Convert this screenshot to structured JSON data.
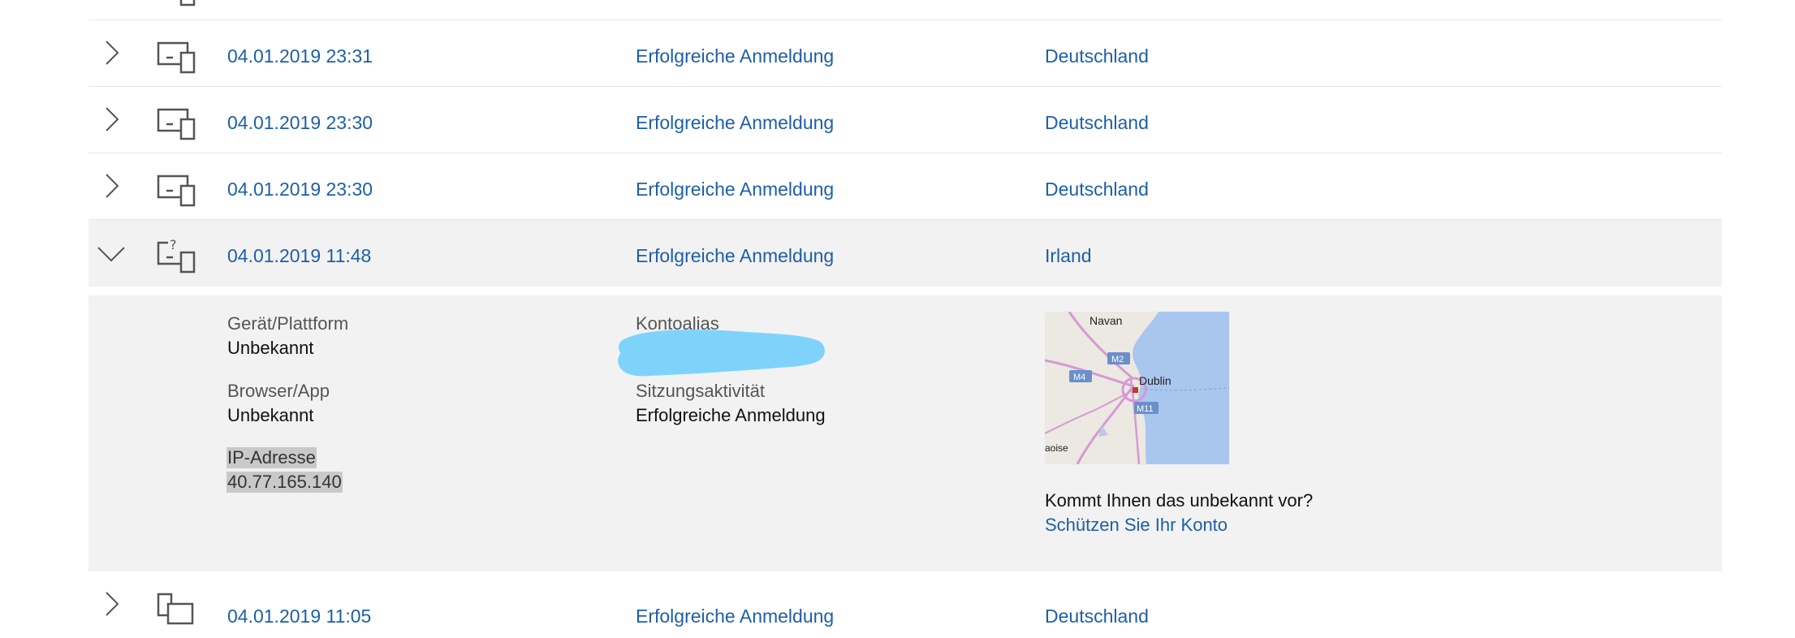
{
  "rows": [
    {
      "datetime": "",
      "activity": "",
      "country": ""
    },
    {
      "datetime": "04.01.2019 23:31",
      "activity": "Erfolgreiche Anmeldung",
      "country": "Deutschland"
    },
    {
      "datetime": "04.01.2019 23:30",
      "activity": "Erfolgreiche Anmeldung",
      "country": "Deutschland"
    },
    {
      "datetime": "04.01.2019 23:30",
      "activity": "Erfolgreiche Anmeldung",
      "country": "Deutschland"
    },
    {
      "datetime": "04.01.2019 11:48",
      "activity": "Erfolgreiche Anmeldung",
      "country": "Irland"
    },
    {
      "datetime": "04.01.2019 11:05",
      "activity": "Erfolgreiche Anmeldung",
      "country": "Deutschland"
    }
  ],
  "detail": {
    "device_label": "Gerät/Plattform",
    "device_value": "Unbekannt",
    "browser_label": "Browser/App",
    "browser_value": "Unbekannt",
    "ip_label": "IP-Adresse",
    "ip_value": "40.77.165.140",
    "alias_label": "Kontoalias",
    "session_label": "Sitzungsaktivität",
    "session_value": "Erfolgreiche Anmeldung",
    "unknown_question": "Kommt Ihnen das unbekannt vor?",
    "protect_link": "Schützen Sie Ihr Konto",
    "map_labels": {
      "navan": "Navan",
      "dublin": "Dublin",
      "m4": "M4",
      "m2": "M2",
      "m11": "M11",
      "laoise": "aoise"
    }
  },
  "colors": {
    "link": "#1d5fa8",
    "expanded_bg": "#f2f2f2",
    "redaction": "#7fd3fb"
  }
}
